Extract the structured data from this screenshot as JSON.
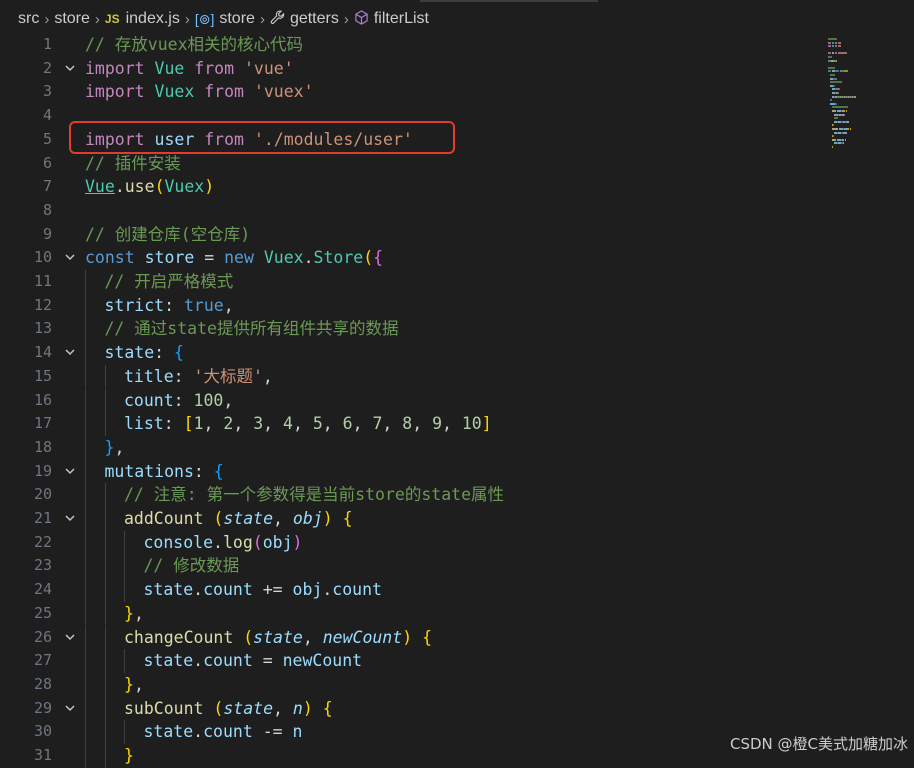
{
  "breadcrumb": {
    "items": [
      {
        "label": "src",
        "icon": ""
      },
      {
        "label": "store",
        "icon": ""
      },
      {
        "label": "index.js",
        "icon": "js-file-icon",
        "icon_text": "JS"
      },
      {
        "label": "store",
        "icon": "variable-symbol-icon",
        "icon_text": "[⊚]"
      },
      {
        "label": "getters",
        "icon": "wrench-icon",
        "icon_text": "🔧"
      },
      {
        "label": "filterList",
        "icon": "cube-icon",
        "icon_text": "⬡"
      }
    ]
  },
  "editor": {
    "lines": [
      {
        "n": "1",
        "fold": "",
        "indent": 0,
        "tokens": [
          [
            "c",
            "// 存放vuex相关的核心代码"
          ]
        ]
      },
      {
        "n": "2",
        "fold": "v",
        "indent": 0,
        "tokens": [
          [
            "k",
            "import"
          ],
          [
            "p",
            " "
          ],
          [
            "cls",
            "Vue"
          ],
          [
            "p",
            " "
          ],
          [
            "k",
            "from"
          ],
          [
            "p",
            " "
          ],
          [
            "s",
            "'vue'"
          ]
        ]
      },
      {
        "n": "3",
        "fold": "",
        "indent": 0,
        "tokens": [
          [
            "k",
            "import"
          ],
          [
            "p",
            " "
          ],
          [
            "cls",
            "Vuex"
          ],
          [
            "p",
            " "
          ],
          [
            "k",
            "from"
          ],
          [
            "p",
            " "
          ],
          [
            "s",
            "'vuex'"
          ]
        ]
      },
      {
        "n": "4",
        "fold": "",
        "indent": 0,
        "tokens": []
      },
      {
        "n": "5",
        "fold": "",
        "indent": 0,
        "tokens": [
          [
            "k",
            "import"
          ],
          [
            "p",
            " "
          ],
          [
            "v",
            "user"
          ],
          [
            "p",
            " "
          ],
          [
            "k",
            "from"
          ],
          [
            "p",
            " "
          ],
          [
            "s",
            "'./modules/user'"
          ]
        ]
      },
      {
        "n": "6",
        "fold": "",
        "indent": 0,
        "tokens": [
          [
            "c",
            "// 插件安装"
          ]
        ]
      },
      {
        "n": "7",
        "fold": "",
        "indent": 0,
        "tokens": [
          [
            "cls ul",
            "Vue"
          ],
          [
            "p",
            "."
          ],
          [
            "f",
            "use"
          ],
          [
            "b1",
            "("
          ],
          [
            "cls",
            "Vuex"
          ],
          [
            "b1",
            ")"
          ]
        ]
      },
      {
        "n": "8",
        "fold": "",
        "indent": 0,
        "tokens": []
      },
      {
        "n": "9",
        "fold": "",
        "indent": 0,
        "tokens": [
          [
            "c",
            "// 创建仓库(空仓库)"
          ]
        ]
      },
      {
        "n": "10",
        "fold": "v",
        "indent": 0,
        "tokens": [
          [
            "kw",
            "const"
          ],
          [
            "p",
            " "
          ],
          [
            "v",
            "store"
          ],
          [
            "p",
            " = "
          ],
          [
            "kw",
            "new"
          ],
          [
            "p",
            " "
          ],
          [
            "cls",
            "Vuex"
          ],
          [
            "p",
            "."
          ],
          [
            "cls",
            "Store"
          ],
          [
            "b1",
            "("
          ],
          [
            "b2",
            "{"
          ]
        ]
      },
      {
        "n": "11",
        "fold": "",
        "indent": 1,
        "tokens": [
          [
            "c",
            "// 开启严格模式"
          ]
        ]
      },
      {
        "n": "12",
        "fold": "",
        "indent": 1,
        "tokens": [
          [
            "prop",
            "strict"
          ],
          [
            "p",
            ": "
          ],
          [
            "kw",
            "true"
          ],
          [
            "p",
            ","
          ]
        ]
      },
      {
        "n": "13",
        "fold": "",
        "indent": 1,
        "tokens": [
          [
            "c",
            "// 通过state提供所有组件共享的数据"
          ]
        ]
      },
      {
        "n": "14",
        "fold": "v",
        "indent": 1,
        "tokens": [
          [
            "prop",
            "state"
          ],
          [
            "p",
            ": "
          ],
          [
            "b3",
            "{"
          ]
        ]
      },
      {
        "n": "15",
        "fold": "",
        "indent": 2,
        "tokens": [
          [
            "prop",
            "title"
          ],
          [
            "p",
            ": "
          ],
          [
            "s",
            "'大标题'"
          ],
          [
            "p",
            ","
          ]
        ]
      },
      {
        "n": "16",
        "fold": "",
        "indent": 2,
        "tokens": [
          [
            "prop",
            "count"
          ],
          [
            "p",
            ": "
          ],
          [
            "n",
            "100"
          ],
          [
            "p",
            ","
          ]
        ]
      },
      {
        "n": "17",
        "fold": "",
        "indent": 2,
        "tokens": [
          [
            "prop",
            "list"
          ],
          [
            "p",
            ": "
          ],
          [
            "b1",
            "["
          ],
          [
            "n",
            "1"
          ],
          [
            "p",
            ", "
          ],
          [
            "n",
            "2"
          ],
          [
            "p",
            ", "
          ],
          [
            "n",
            "3"
          ],
          [
            "p",
            ", "
          ],
          [
            "n",
            "4"
          ],
          [
            "p",
            ", "
          ],
          [
            "n",
            "5"
          ],
          [
            "p",
            ", "
          ],
          [
            "n",
            "6"
          ],
          [
            "p",
            ", "
          ],
          [
            "n",
            "7"
          ],
          [
            "p",
            ", "
          ],
          [
            "n",
            "8"
          ],
          [
            "p",
            ", "
          ],
          [
            "n",
            "9"
          ],
          [
            "p",
            ", "
          ],
          [
            "n",
            "10"
          ],
          [
            "b1",
            "]"
          ]
        ]
      },
      {
        "n": "18",
        "fold": "",
        "indent": 1,
        "tokens": [
          [
            "b3",
            "}"
          ],
          [
            "p",
            ","
          ]
        ]
      },
      {
        "n": "19",
        "fold": "v",
        "indent": 1,
        "tokens": [
          [
            "prop",
            "mutations"
          ],
          [
            "p",
            ": "
          ],
          [
            "b3",
            "{"
          ]
        ]
      },
      {
        "n": "20",
        "fold": "",
        "indent": 2,
        "tokens": [
          [
            "c",
            "// 注意: 第一个参数得是当前store的state属性"
          ]
        ]
      },
      {
        "n": "21",
        "fold": "v",
        "indent": 2,
        "tokens": [
          [
            "f",
            "addCount"
          ],
          [
            "p",
            " "
          ],
          [
            "b1",
            "("
          ],
          [
            "param",
            "state"
          ],
          [
            "p",
            ", "
          ],
          [
            "param",
            "obj"
          ],
          [
            "b1",
            ")"
          ],
          [
            "p",
            " "
          ],
          [
            "b1",
            "{"
          ]
        ]
      },
      {
        "n": "22",
        "fold": "",
        "indent": 3,
        "tokens": [
          [
            "v",
            "console"
          ],
          [
            "p",
            "."
          ],
          [
            "f",
            "log"
          ],
          [
            "b2",
            "("
          ],
          [
            "v",
            "obj"
          ],
          [
            "b2",
            ")"
          ]
        ]
      },
      {
        "n": "23",
        "fold": "",
        "indent": 3,
        "tokens": [
          [
            "c",
            "// 修改数据"
          ]
        ]
      },
      {
        "n": "24",
        "fold": "",
        "indent": 3,
        "tokens": [
          [
            "v",
            "state"
          ],
          [
            "p",
            "."
          ],
          [
            "prop",
            "count"
          ],
          [
            "p",
            " += "
          ],
          [
            "v",
            "obj"
          ],
          [
            "p",
            "."
          ],
          [
            "prop",
            "count"
          ]
        ]
      },
      {
        "n": "25",
        "fold": "",
        "indent": 2,
        "tokens": [
          [
            "b1",
            "}"
          ],
          [
            "p",
            ","
          ]
        ]
      },
      {
        "n": "26",
        "fold": "v",
        "indent": 2,
        "tokens": [
          [
            "f",
            "changeCount"
          ],
          [
            "p",
            " "
          ],
          [
            "b1",
            "("
          ],
          [
            "param",
            "state"
          ],
          [
            "p",
            ", "
          ],
          [
            "param",
            "newCount"
          ],
          [
            "b1",
            ")"
          ],
          [
            "p",
            " "
          ],
          [
            "b1",
            "{"
          ]
        ]
      },
      {
        "n": "27",
        "fold": "",
        "indent": 3,
        "tokens": [
          [
            "v",
            "state"
          ],
          [
            "p",
            "."
          ],
          [
            "prop",
            "count"
          ],
          [
            "p",
            " = "
          ],
          [
            "v",
            "newCount"
          ]
        ]
      },
      {
        "n": "28",
        "fold": "",
        "indent": 2,
        "tokens": [
          [
            "b1",
            "}"
          ],
          [
            "p",
            ","
          ]
        ]
      },
      {
        "n": "29",
        "fold": "v",
        "indent": 2,
        "tokens": [
          [
            "f",
            "subCount"
          ],
          [
            "p",
            " "
          ],
          [
            "b1",
            "("
          ],
          [
            "param",
            "state"
          ],
          [
            "p",
            ", "
          ],
          [
            "param",
            "n"
          ],
          [
            "b1",
            ")"
          ],
          [
            "p",
            " "
          ],
          [
            "b1",
            "{"
          ]
        ]
      },
      {
        "n": "30",
        "fold": "",
        "indent": 3,
        "tokens": [
          [
            "v",
            "state"
          ],
          [
            "p",
            "."
          ],
          [
            "prop",
            "count"
          ],
          [
            "p",
            " -= "
          ],
          [
            "v",
            "n"
          ]
        ]
      },
      {
        "n": "31",
        "fold": "",
        "indent": 2,
        "tokens": [
          [
            "b1",
            "}"
          ]
        ]
      }
    ]
  },
  "highlight": {
    "line": "5",
    "color": "#e03e2d"
  },
  "watermark": {
    "text": "CSDN @橙C美式加糖加冰"
  },
  "colors": {
    "background": "#1e1e1e",
    "comment": "#6a9955",
    "keyword": "#c586c0",
    "string": "#ce9178"
  }
}
